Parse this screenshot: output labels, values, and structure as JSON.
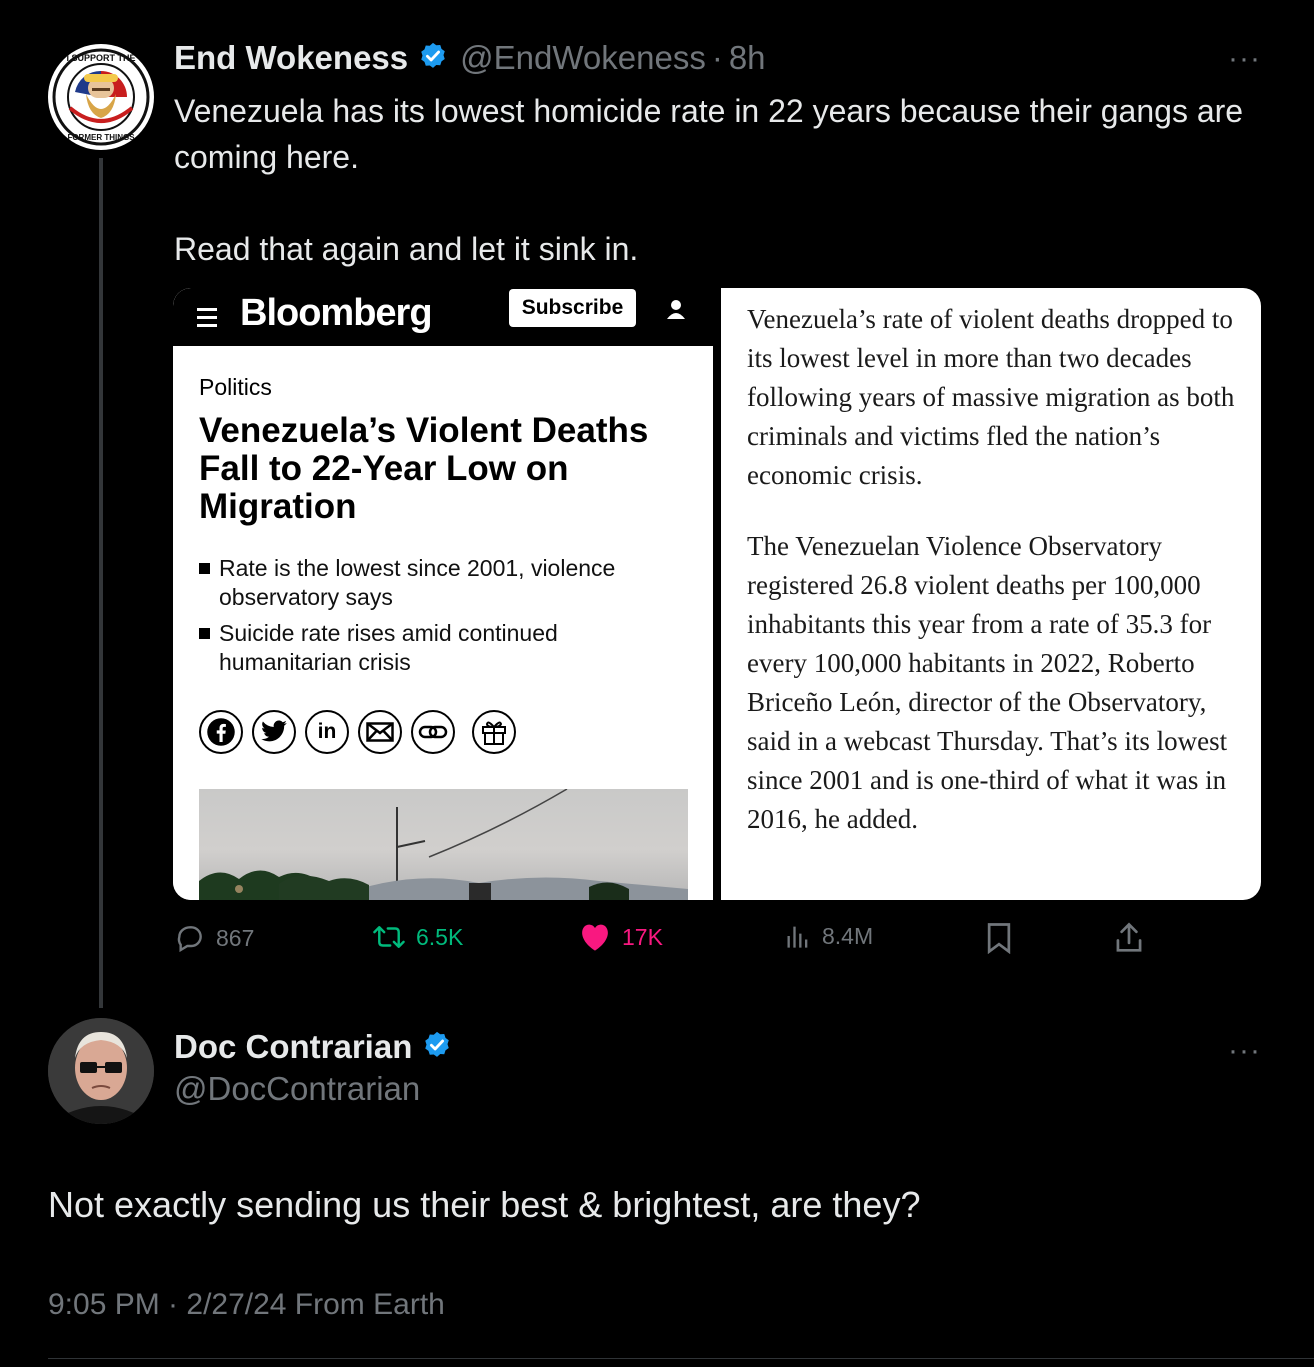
{
  "tweet": {
    "author_name": "End Wokeness",
    "handle": "@EndWokeness",
    "separator": "·",
    "time": "8h",
    "more": "···",
    "avatar_text_top": "I SUPPORT THE",
    "avatar_text_bottom": "FORMER THINGS",
    "text_line1": "Venezuela has its lowest homicide rate in 22 years because their gangs are coming here.",
    "text_line2": "Read that again and let it sink in.",
    "stats": {
      "replies": "867",
      "reposts": "6.5K",
      "likes": "17K",
      "views": "8.4M"
    }
  },
  "article": {
    "publisher": "Bloomberg",
    "subscribe": "Subscribe",
    "section": "Politics",
    "headline": "Venezuela’s Violent Deaths Fall to 22-Year Low on Migration",
    "bullets": [
      "Rate is the lowest since 2001, violence observatory says",
      "Suicide rate rises amid continued humanitarian crisis"
    ],
    "share_linkedin": "in",
    "body_p1": "Venezuela’s rate of violent deaths dropped to its lowest level in more than two decades following years of massive migration as both criminals and victims fled the nation’s economic crisis.",
    "body_p2": "The Venezuelan Violence Observatory registered 26.8 violent deaths per 100,000 inhabitants this year from a rate of 35.3 for every 100,000 habitants in 2022, Roberto Briceño León, director of the Observatory, said in a webcast Thursday. That’s its lowest since 2001 and is one-third of what it was in 2016, he added."
  },
  "reply": {
    "author_name": "Doc Contrarian",
    "handle": "@DocContrarian",
    "more": "···",
    "text": "Not exactly sending us their best & brightest, are they?",
    "meta": "9:05 PM · 2/27/24 From Earth"
  },
  "colors": {
    "background": "#000000",
    "text": "#e7e9ea",
    "muted": "#71767b",
    "verified": "#1d9bf0",
    "repost": "#00ba7c",
    "like": "#f91880"
  }
}
